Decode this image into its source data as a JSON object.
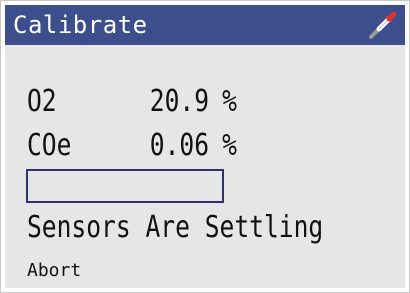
{
  "window": {
    "title": "Calibrate"
  },
  "icons": {
    "probe": "probe-icon"
  },
  "readings": [
    {
      "label": "O2",
      "value": "20.9",
      "unit": "%"
    },
    {
      "label": "COe",
      "value": "0.06",
      "unit": "%"
    }
  ],
  "progress": {
    "fraction": 0
  },
  "status": {
    "text": "Sensors Are Settling"
  },
  "actions": {
    "abort_label": "Abort"
  },
  "colors": {
    "titlebar": "#3d4e8c",
    "screen_background": "#e6e6e6",
    "progress_border": "#2f2f72",
    "text": "#111111",
    "icon_red": "#e03030"
  }
}
